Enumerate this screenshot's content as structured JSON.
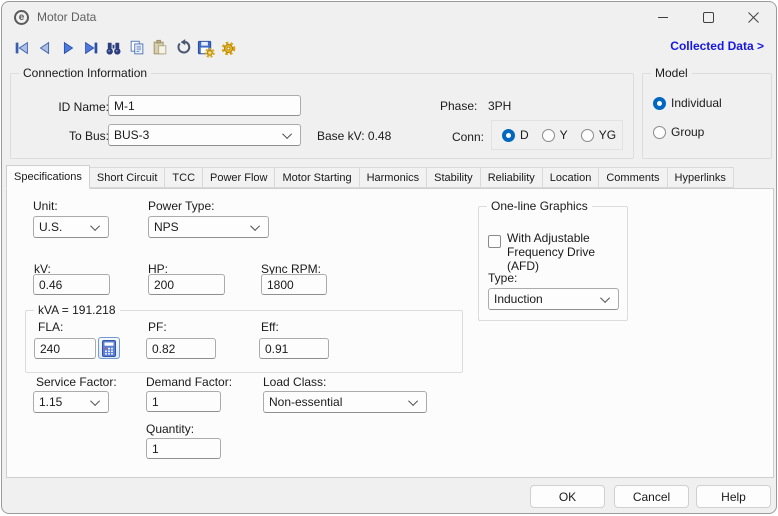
{
  "window": {
    "title": "Motor Data"
  },
  "toolbar": {
    "collected_data_link": "Collected Data >",
    "icons": [
      "first-record",
      "previous-record",
      "next-record",
      "last-record",
      "find",
      "copy",
      "paste",
      "undo",
      "save-options",
      "settings"
    ]
  },
  "connection": {
    "group_label": "Connection Information",
    "id_name_label": "ID Name:",
    "id_name_value": "M-1",
    "to_bus_label": "To Bus:",
    "to_bus_value": "BUS-3",
    "base_kv_text": "Base kV: 0.48",
    "phase_label": "Phase:",
    "phase_value": "3PH",
    "conn_label": "Conn:",
    "conn_options": [
      {
        "label": "D",
        "selected": true
      },
      {
        "label": "Y",
        "selected": false
      },
      {
        "label": "YG",
        "selected": false
      }
    ]
  },
  "model": {
    "group_label": "Model",
    "options": [
      {
        "label": "Individual",
        "selected": true
      },
      {
        "label": "Group",
        "selected": false
      }
    ]
  },
  "tabs": {
    "active": "Specifications",
    "items": [
      "Specifications",
      "Short Circuit",
      "TCC",
      "Power Flow",
      "Motor Starting",
      "Harmonics",
      "Stability",
      "Reliability",
      "Location",
      "Comments",
      "Hyperlinks"
    ]
  },
  "specifications": {
    "unit_label": "Unit:",
    "unit_value": "U.S.",
    "power_type_label": "Power Type:",
    "power_type_value": "NPS",
    "kv_label": "kV:",
    "kv_value": "0.46",
    "hp_label": "HP:",
    "hp_value": "200",
    "sync_rpm_label": "Sync RPM:",
    "sync_rpm_value": "1800",
    "kva_group_label": "kVA = 191.218",
    "fla_label": "FLA:",
    "fla_value": "240",
    "pf_label": "PF:",
    "pf_value": "0.82",
    "eff_label": "Eff:",
    "eff_value": "0.91",
    "service_factor_label": "Service Factor:",
    "service_factor_value": "1.15",
    "demand_factor_label": "Demand Factor:",
    "demand_factor_value": "1",
    "load_class_label": "Load Class:",
    "load_class_value": "Non-essential",
    "quantity_label": "Quantity:",
    "quantity_value": "1"
  },
  "one_line_graphics": {
    "group_label": "One-line Graphics",
    "afd_checkbox_label": "With Adjustable Frequency Drive (AFD)",
    "afd_checked": false,
    "type_label": "Type:",
    "type_value": "Induction"
  },
  "footer": {
    "ok_label": "OK",
    "cancel_label": "Cancel",
    "help_label": "Help"
  },
  "colors": {
    "accent_blue": "#0067c0",
    "link_blue": "#1717dd",
    "dialog_bg": "#f0f0f0",
    "panel_bg": "#fcfcfc"
  }
}
